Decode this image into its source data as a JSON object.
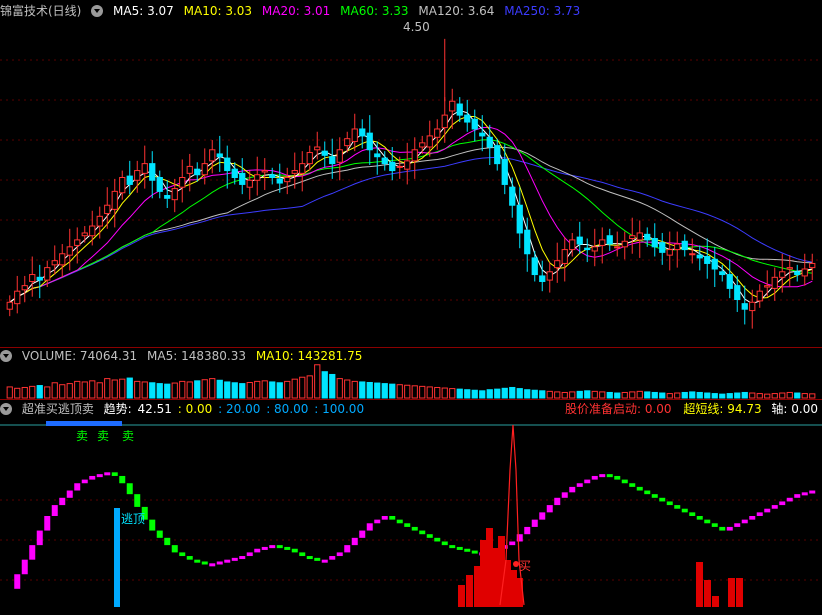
{
  "main_header": {
    "title": "锦富技术(日线)",
    "ma5": "MA5: 3.07",
    "ma10": "MA10: 3.03",
    "ma20": "MA20: 3.01",
    "ma60": "MA60: 3.33",
    "ma120": "MA120: 3.64",
    "ma250": "MA250: 3.73"
  },
  "high_marker": "4.50",
  "volume_header": {
    "label": "VOLUME: 74064.31",
    "ma5": "MA5: 148380.33",
    "ma10": "MA10: 143281.75"
  },
  "indicator_header": {
    "title": "超准买逃顶卖",
    "trend_label": "趋势:",
    "trend_value": "42.51",
    "levels": [
      ": 0.00",
      ": 20.00",
      ": 80.00",
      ": 100.00"
    ],
    "ready_label": "股价准备启动: 0.00",
    "short_label": "超短线: 94.73",
    "axis_label": "轴: 0.00"
  },
  "signals": {
    "sell_marks": [
      "卖",
      "卖",
      "卖"
    ],
    "escape_top": "逃顶",
    "buy": "买"
  },
  "colors": {
    "up": "#ff3232",
    "down": "#00e4ff",
    "ma5": "#ffffff",
    "ma10": "#ffff00",
    "ma20": "#ff00ff",
    "ma60": "#00ff00",
    "ma120": "#c0c0c0",
    "ma250": "#3c3cff",
    "separator": "#8b0000"
  },
  "chart_data": {
    "type": "candlestick",
    "price_high": 4.5,
    "price_closes": [
      2.6,
      2.68,
      2.72,
      2.8,
      2.76,
      2.85,
      2.9,
      2.95,
      3.0,
      3.05,
      3.1,
      3.15,
      3.22,
      3.3,
      3.4,
      3.5,
      3.45,
      3.55,
      3.6,
      3.48,
      3.4,
      3.35,
      3.42,
      3.5,
      3.58,
      3.52,
      3.6,
      3.7,
      3.65,
      3.55,
      3.5,
      3.45,
      3.48,
      3.52,
      3.55,
      3.5,
      3.46,
      3.5,
      3.55,
      3.6,
      3.68,
      3.72,
      3.66,
      3.6,
      3.7,
      3.78,
      3.85,
      3.8,
      3.7,
      3.65,
      3.6,
      3.55,
      3.58,
      3.62,
      3.7,
      3.75,
      3.8,
      3.85,
      3.95,
      4.05,
      3.95,
      3.9,
      3.85,
      3.8,
      3.72,
      3.6,
      3.45,
      3.3,
      3.1,
      2.95,
      2.8,
      2.75,
      2.82,
      2.9,
      2.98,
      3.05,
      3.02,
      2.98,
      3.0,
      3.05,
      3.02,
      3.0,
      3.04,
      3.08,
      3.1,
      3.05,
      3.0,
      2.96,
      2.98,
      3.02,
      2.98,
      2.95,
      2.92,
      2.88,
      2.84,
      2.8,
      2.7,
      2.62,
      2.55,
      2.6,
      2.68,
      2.72,
      2.78,
      2.82,
      2.85,
      2.8,
      2.84,
      2.88
    ],
    "volume_values": [
      40,
      35,
      38,
      42,
      45,
      40,
      55,
      48,
      52,
      60,
      58,
      62,
      55,
      70,
      65,
      68,
      72,
      60,
      58,
      55,
      52,
      50,
      54,
      60,
      58,
      62,
      66,
      70,
      64,
      58,
      55,
      52,
      56,
      60,
      62,
      58,
      55,
      60,
      68,
      75,
      80,
      120,
      95,
      85,
      70,
      65,
      60,
      58,
      56,
      54,
      52,
      50,
      48,
      46,
      44,
      42,
      40,
      38,
      36,
      34,
      32,
      30,
      28,
      26,
      30,
      32,
      35,
      38,
      34,
      30,
      28,
      26,
      24,
      22,
      20,
      22,
      24,
      26,
      24,
      22,
      20,
      18,
      20,
      22,
      24,
      22,
      20,
      18,
      16,
      18,
      20,
      22,
      20,
      18,
      16,
      14,
      16,
      18,
      20,
      18,
      16,
      14,
      16,
      18,
      20,
      18,
      16,
      15
    ],
    "indicator_trend": [
      10,
      18,
      26,
      34,
      42,
      50,
      56,
      60,
      64,
      68,
      70,
      72,
      73,
      74,
      72,
      68,
      62,
      55,
      48,
      42,
      38,
      34,
      30,
      28,
      26,
      25,
      24,
      24,
      25,
      26,
      27,
      28,
      30,
      32,
      33,
      34,
      33,
      32,
      30,
      28,
      27,
      26,
      26,
      28,
      30,
      34,
      38,
      42,
      46,
      48,
      50,
      48,
      46,
      44,
      42,
      40,
      38,
      36,
      34,
      33,
      32,
      31,
      30,
      30,
      31,
      32,
      34,
      36,
      40,
      44,
      48,
      52,
      56,
      60,
      63,
      66,
      68,
      70,
      72,
      73,
      72,
      70,
      68,
      66,
      64,
      62,
      60,
      58,
      56,
      54,
      52,
      50,
      48,
      46,
      44,
      42,
      44,
      46,
      48,
      50,
      52,
      54,
      56,
      58,
      60,
      62,
      63,
      64
    ],
    "ylim_indicator": [
      0,
      100
    ]
  }
}
